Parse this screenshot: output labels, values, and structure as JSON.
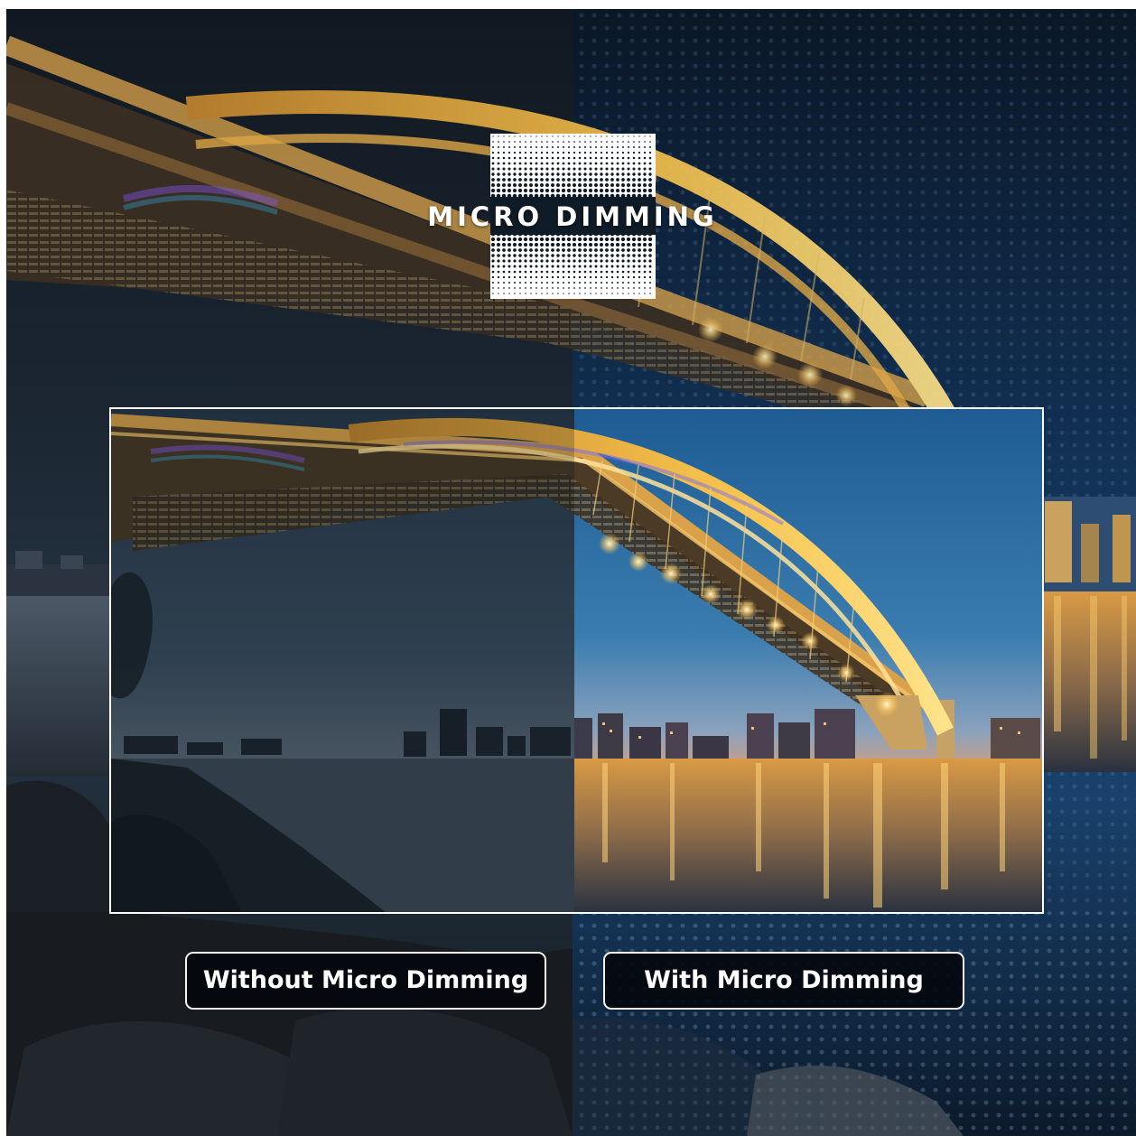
{
  "logo": {
    "title": "MICRO DIMMING",
    "icon": "dot-matrix-icon"
  },
  "comparison": {
    "left_label": "Without Micro Dimming",
    "right_label": "With Micro Dimming"
  },
  "scene": {
    "subject": "bridge-at-night",
    "colors": {
      "dark_sky": "#0e1a26",
      "blue_sky": "#1d4e7c",
      "bridge_light": "#f5b940",
      "water_glow": "#e8a440",
      "frame_border": "#ffffff",
      "label_bg": "#05080e"
    }
  }
}
